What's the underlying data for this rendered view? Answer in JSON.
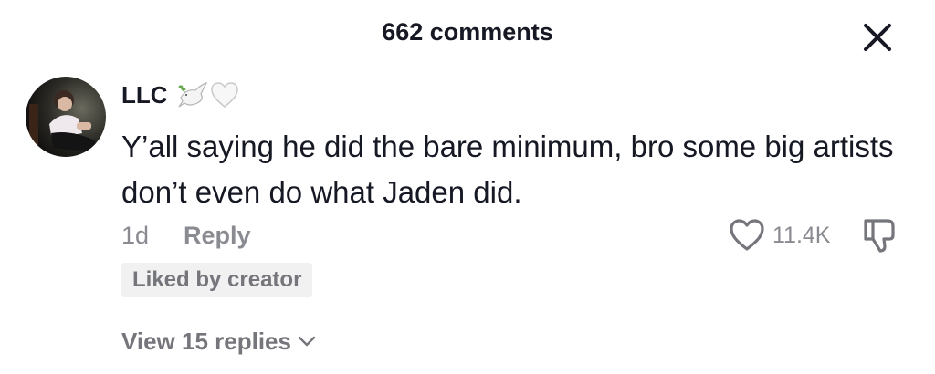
{
  "header": {
    "title": "662 comments",
    "close_icon": "close-icon"
  },
  "comment": {
    "username": "LLC",
    "emojis": [
      "dove-emoji",
      "white-heart-emoji"
    ],
    "text": "Y’all saying he did the bare minimum, bro some big artists don’t even do what Jaden did.",
    "time": "1d",
    "reply_label": "Reply",
    "like_count": "11.4K",
    "liked_badge": "Liked by creator",
    "view_replies": "View 15 replies"
  },
  "colors": {
    "text_primary": "#161823",
    "text_secondary": "#8a8b91",
    "badge_bg": "#f1f1f2"
  }
}
